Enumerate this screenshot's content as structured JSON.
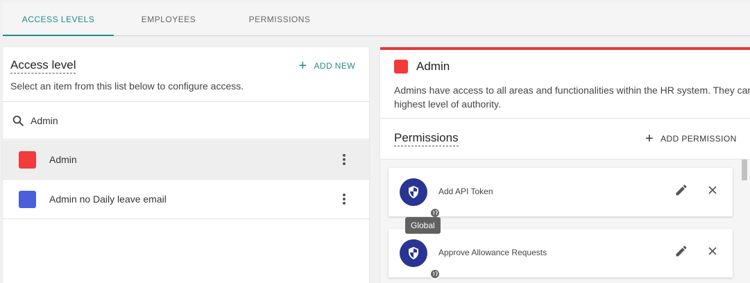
{
  "tabs": [
    {
      "label": "ACCESS LEVELS",
      "active": true
    },
    {
      "label": "EMPLOYEES",
      "active": false
    },
    {
      "label": "PERMISSIONS",
      "active": false
    }
  ],
  "access_level_panel": {
    "title": "Access level",
    "subtitle": "Select an item from this list below to configure access.",
    "add_new_label": "ADD NEW",
    "search": {
      "value": "Admin",
      "icon": "search-icon"
    },
    "items": [
      {
        "label": "Admin",
        "color": "#f23b3b",
        "selected": true
      },
      {
        "label": "Admin no Daily leave email",
        "color": "#4a5fd9",
        "selected": false
      }
    ]
  },
  "detail_panel": {
    "accent_color": "#e53935",
    "name": "Admin",
    "description": "Admins have access to all areas and functionalities within the HR system. They can highest level of authority.",
    "permissions_title": "Permissions",
    "add_permission_label": "ADD PERMISSION",
    "permissions": [
      {
        "label": "Add API Token",
        "icon": "shield-icon",
        "scope_icon": "globe-icon"
      },
      {
        "label": "Approve Allowance Requests",
        "icon": "shield-icon",
        "scope_icon": "globe-icon"
      }
    ],
    "tooltip": "Global"
  }
}
